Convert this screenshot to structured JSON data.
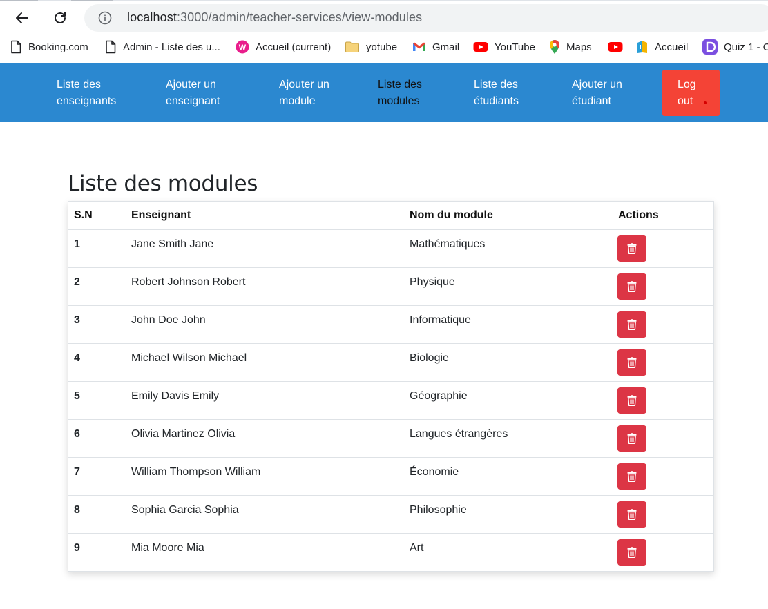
{
  "browser": {
    "url_host": "localhost",
    "url_path": ":3000/admin/teacher-services/view-modules",
    "bookmarks": [
      {
        "label": "Booking.com",
        "icon": "page-icon"
      },
      {
        "label": "Admin - Liste des u...",
        "icon": "page-icon"
      },
      {
        "label": "Accueil (current)",
        "icon": "pink-app-icon"
      },
      {
        "label": "yotube",
        "icon": "folder-icon"
      },
      {
        "label": "Gmail",
        "icon": "gmail-icon"
      },
      {
        "label": "YouTube",
        "icon": "youtube-icon"
      },
      {
        "label": "Maps",
        "icon": "maps-icon"
      },
      {
        "label": "",
        "icon": "youtube-icon"
      },
      {
        "label": "Accueil",
        "icon": "app-icon"
      },
      {
        "label": "Quiz 1 - C",
        "icon": "quiz-icon"
      }
    ]
  },
  "nav": {
    "items": [
      {
        "line1": "Liste des",
        "line2": "enseignants"
      },
      {
        "line1": "Ajouter un",
        "line2": "enseignant"
      },
      {
        "line1": "Ajouter un",
        "line2": "module"
      },
      {
        "line1": "Liste des",
        "line2": "modules"
      },
      {
        "line1": "Liste des",
        "line2": "étudiants"
      },
      {
        "line1": "Ajouter un",
        "line2": "étudiant"
      }
    ],
    "logout_line1": "Log",
    "logout_line2": "out"
  },
  "page": {
    "title": "Liste des modules"
  },
  "table": {
    "headers": {
      "sn": "S.N",
      "teacher": "Enseignant",
      "module": "Nom du module",
      "actions": "Actions"
    },
    "rows": [
      {
        "sn": "1",
        "teacher": "Jane Smith Jane",
        "module": "Mathématiques"
      },
      {
        "sn": "2",
        "teacher": "Robert Johnson Robert",
        "module": "Physique"
      },
      {
        "sn": "3",
        "teacher": "John Doe John",
        "module": "Informatique"
      },
      {
        "sn": "4",
        "teacher": "Michael Wilson Michael",
        "module": "Biologie"
      },
      {
        "sn": "5",
        "teacher": "Emily Davis Emily",
        "module": "Géographie"
      },
      {
        "sn": "6",
        "teacher": "Olivia Martinez Olivia",
        "module": "Langues étrangères"
      },
      {
        "sn": "7",
        "teacher": "William Thompson William",
        "module": "Économie"
      },
      {
        "sn": "8",
        "teacher": "Sophia Garcia Sophia",
        "module": "Philosophie"
      },
      {
        "sn": "9",
        "teacher": "Mia Moore Mia",
        "module": "Art"
      }
    ]
  },
  "colors": {
    "navbar": "#2b88d0",
    "logout": "#f44336",
    "delete": "#dc3545"
  }
}
